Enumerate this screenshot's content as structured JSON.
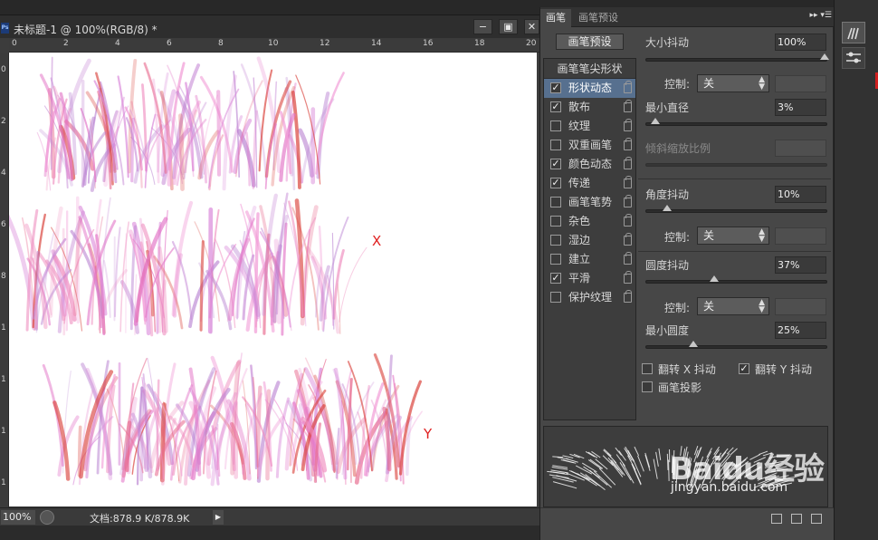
{
  "document": {
    "app_badge": "Ps",
    "title": "未标题-1 @ 100%(RGB/8) *",
    "window_buttons": [
      "−",
      "▣",
      "✕"
    ],
    "ruler_top_ticks": [
      "0",
      "2",
      "4",
      "6",
      "8",
      "10",
      "12",
      "14",
      "16",
      "18",
      "20"
    ],
    "ruler_left_ticks": [
      "0",
      "2",
      "4",
      "6",
      "8",
      "1",
      "1",
      "1",
      "1"
    ],
    "canvas_labels": {
      "x": "X",
      "y": "Y"
    },
    "status": {
      "zoom": "100%",
      "doc_size": "文档:878.9 K/878.9K"
    }
  },
  "brush_panel": {
    "tabs": [
      "画笔",
      "画笔预设"
    ],
    "menu_glyphs": "▸▸ ▾☰",
    "preset_button": "画笔预设",
    "options_header": "画笔笔尖形状",
    "options": [
      {
        "label": "形状动态",
        "checked": true,
        "selected": true
      },
      {
        "label": "散布",
        "checked": true,
        "selected": false
      },
      {
        "label": "纹理",
        "checked": false,
        "selected": false
      },
      {
        "label": "双重画笔",
        "checked": false,
        "selected": false
      },
      {
        "label": "颜色动态",
        "checked": true,
        "selected": false
      },
      {
        "label": "传递",
        "checked": true,
        "selected": false
      },
      {
        "label": "画笔笔势",
        "checked": false,
        "selected": false
      },
      {
        "label": "杂色",
        "checked": false,
        "selected": false
      },
      {
        "label": "湿边",
        "checked": false,
        "selected": false
      },
      {
        "label": "建立",
        "checked": false,
        "selected": false
      },
      {
        "label": "平滑",
        "checked": true,
        "selected": false
      },
      {
        "label": "保护纹理",
        "checked": false,
        "selected": false
      }
    ],
    "settings": {
      "size_jitter_label": "大小抖动",
      "size_jitter_value": "100%",
      "size_jitter_pct": 100,
      "control_label": "控制:",
      "control_value_1": "关",
      "min_diameter_label": "最小直径",
      "min_diameter_value": "3%",
      "min_diameter_pct": 3,
      "tilt_scale_label": "倾斜缩放比例",
      "angle_jitter_label": "角度抖动",
      "angle_jitter_value": "10%",
      "angle_jitter_pct": 10,
      "control_value_2": "关",
      "roundness_jitter_label": "圆度抖动",
      "roundness_jitter_value": "37%",
      "roundness_jitter_pct": 37,
      "control_value_3": "关",
      "min_roundness_label": "最小圆度",
      "min_roundness_value": "25%",
      "min_roundness_pct": 25,
      "flip_x_label": "翻转 X 抖动",
      "flip_x_checked": false,
      "flip_y_label": "翻转 Y 抖动",
      "flip_y_checked": true,
      "brush_projection_label": "画笔投影",
      "brush_projection_checked": false
    }
  },
  "watermark": {
    "logo": "Baidu经验",
    "url": "jingyan.baidu.com"
  },
  "colors": {
    "accent_selected": "#57708f",
    "stroke_pink": "#e377c8",
    "stroke_red": "#d9413a",
    "axis_label_red": "#e02020"
  }
}
